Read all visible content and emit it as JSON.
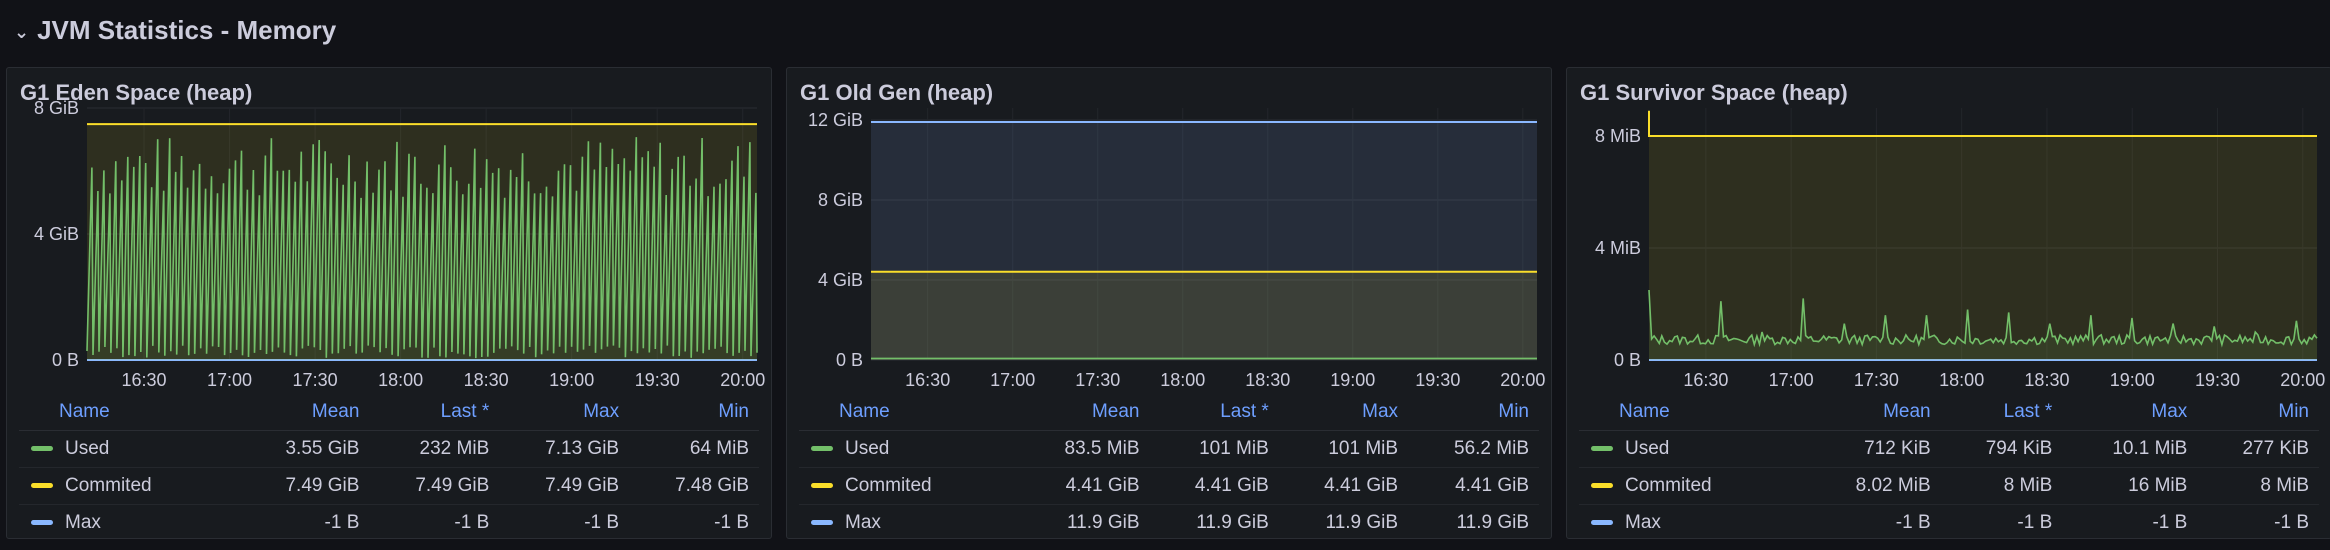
{
  "row": {
    "chevron": "⌄",
    "title": "JVM Statistics - Memory"
  },
  "colors": {
    "used": "#73bf69",
    "commited": "#fade2a",
    "max": "#8ab8ff",
    "accent": "#6e9fff"
  },
  "legend_headers": {
    "name": "Name",
    "mean": "Mean",
    "last": "Last *",
    "max": "Max",
    "min": "Min"
  },
  "panels": [
    {
      "title": "G1 Eden Space (heap)",
      "legend": [
        {
          "name": "Used",
          "mean": "3.55 GiB",
          "last": "232 MiB",
          "max": "7.13 GiB",
          "min": "64 MiB"
        },
        {
          "name": "Commited",
          "mean": "7.49 GiB",
          "last": "7.49 GiB",
          "max": "7.49 GiB",
          "min": "7.48 GiB"
        },
        {
          "name": "Max",
          "mean": "-1 B",
          "last": "-1 B",
          "max": "-1 B",
          "min": "-1 B"
        }
      ]
    },
    {
      "title": "G1 Old Gen (heap)",
      "legend": [
        {
          "name": "Used",
          "mean": "83.5 MiB",
          "last": "101 MiB",
          "max": "101 MiB",
          "min": "56.2 MiB"
        },
        {
          "name": "Commited",
          "mean": "4.41 GiB",
          "last": "4.41 GiB",
          "max": "4.41 GiB",
          "min": "4.41 GiB"
        },
        {
          "name": "Max",
          "mean": "11.9 GiB",
          "last": "11.9 GiB",
          "max": "11.9 GiB",
          "min": "11.9 GiB"
        }
      ]
    },
    {
      "title": "G1 Survivor Space (heap)",
      "legend": [
        {
          "name": "Used",
          "mean": "712 KiB",
          "last": "794 KiB",
          "max": "10.1 MiB",
          "min": "277 KiB"
        },
        {
          "name": "Commited",
          "mean": "8.02 MiB",
          "last": "8 MiB",
          "max": "16 MiB",
          "min": "8 MiB"
        },
        {
          "name": "Max",
          "mean": "-1 B",
          "last": "-1 B",
          "max": "-1 B",
          "min": "-1 B"
        }
      ]
    }
  ],
  "chart_data": [
    {
      "type": "line",
      "title": "G1 Eden Space (heap)",
      "unit": "GiB",
      "ylim": [
        0,
        8
      ],
      "yticks": [
        "0 B",
        "4 GiB",
        "8 GiB"
      ],
      "xlim": [
        "16:10",
        "20:05"
      ],
      "xticks": [
        "16:30",
        "17:00",
        "17:30",
        "18:00",
        "18:30",
        "19:00",
        "19:30",
        "20:00"
      ],
      "series": [
        {
          "name": "Used",
          "pattern": "sawtooth",
          "min": 0.06,
          "max": 7.13,
          "cycles": 112,
          "last": 0.23
        },
        {
          "name": "Commited",
          "constant": 7.49
        },
        {
          "name": "Max",
          "constant": 0
        }
      ]
    },
    {
      "type": "line",
      "title": "G1 Old Gen (heap)",
      "unit": "GiB",
      "ylim": [
        0,
        12.6
      ],
      "yticks": [
        "0 B",
        "4 GiB",
        "8 GiB",
        "12 GiB"
      ],
      "xlim": [
        "16:10",
        "20:05"
      ],
      "xticks": [
        "16:30",
        "17:00",
        "17:30",
        "18:00",
        "18:30",
        "19:00",
        "19:30",
        "20:00"
      ],
      "series": [
        {
          "name": "Used",
          "constant": 0.08
        },
        {
          "name": "Commited",
          "constant": 4.41
        },
        {
          "name": "Max",
          "constant": 11.9
        }
      ]
    },
    {
      "type": "line",
      "title": "G1 Survivor Space (heap)",
      "unit": "MiB",
      "ylim": [
        0,
        9
      ],
      "yticks": [
        "0 B",
        "4 MiB",
        "8 MiB"
      ],
      "xlim": [
        "16:10",
        "20:05"
      ],
      "xticks": [
        "16:30",
        "17:00",
        "17:30",
        "18:00",
        "18:30",
        "19:00",
        "19:30",
        "20:00"
      ],
      "series": [
        {
          "name": "Used",
          "pattern": "noisy-spikes",
          "baseline": 0.55,
          "start": 2.5,
          "spikes": [
            2.6,
            2.1,
            1.0,
            2.2,
            1.3,
            1.6,
            1.6,
            1.8,
            1.7,
            1.3,
            1.6,
            1.5,
            1.3,
            1.2,
            1.0,
            1.4
          ],
          "last": 0.78
        },
        {
          "name": "Commited",
          "constant": 8.0,
          "start_spike": 8.9
        },
        {
          "name": "Max",
          "constant": 0
        }
      ]
    }
  ]
}
